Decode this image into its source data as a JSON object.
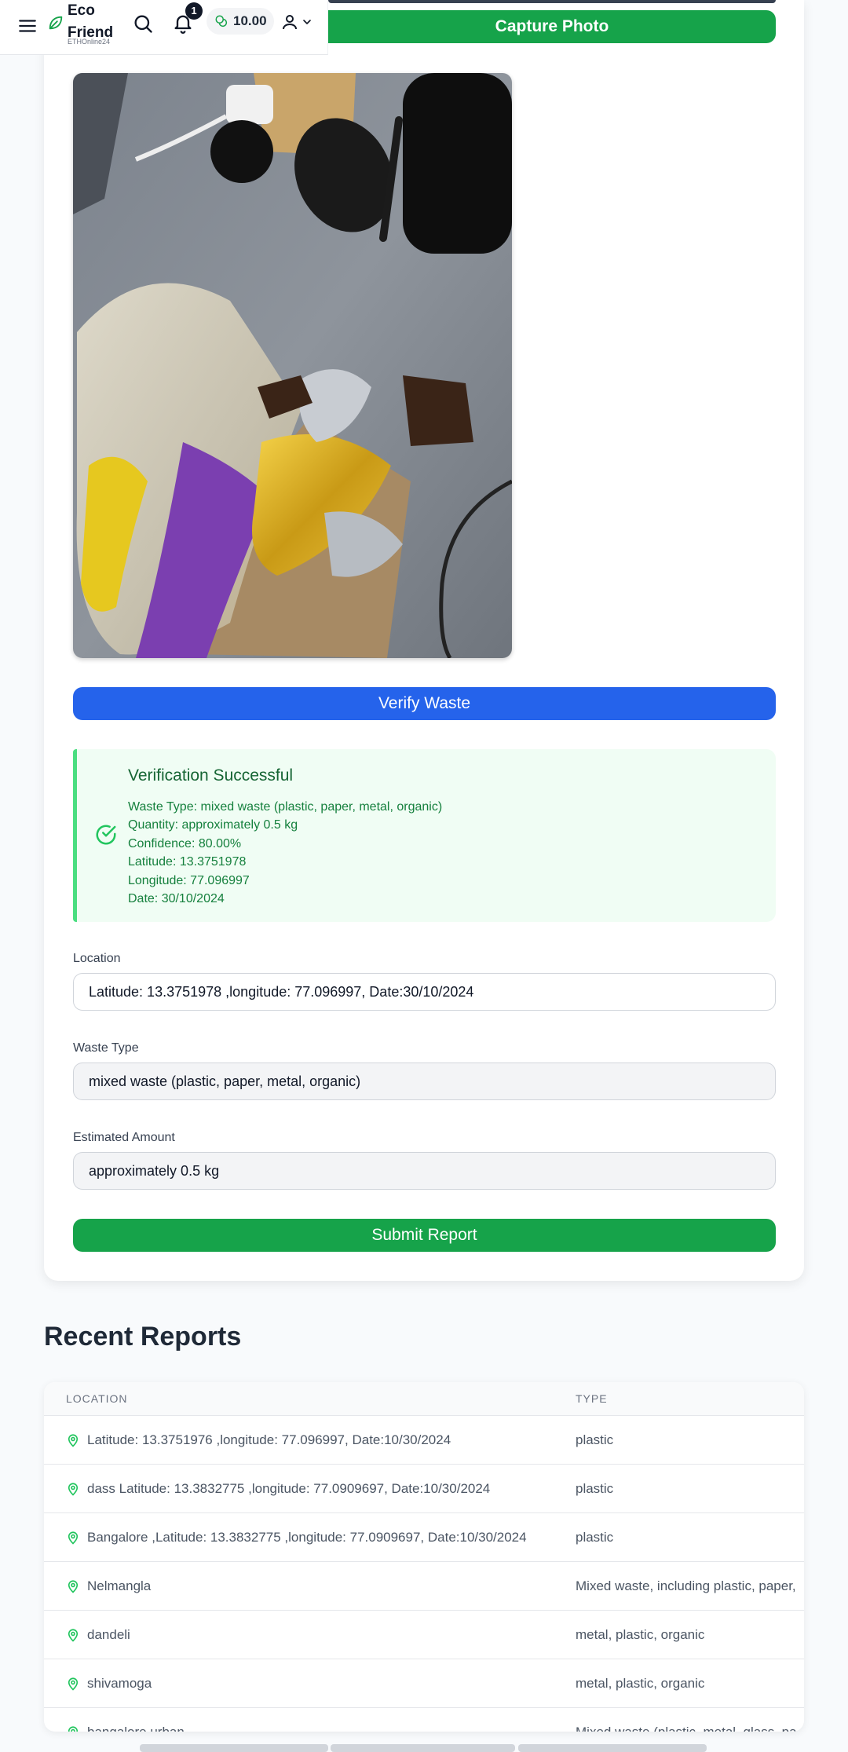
{
  "header": {
    "logo_text": "Eco\nFriend",
    "logo_line1": "Eco",
    "logo_line2": "Friend",
    "logo_sub": "ETHOnline24",
    "notification_count": "1",
    "balance": "10.00"
  },
  "capture": {
    "button_label": "Capture Photo"
  },
  "verify": {
    "button_label": "Verify Waste"
  },
  "verification": {
    "title": "Verification Successful",
    "lines": [
      "Waste Type: mixed waste (plastic, paper, metal, organic)",
      "Quantity: approximately 0.5 kg",
      "Confidence: 80.00%",
      "Latitude: 13.3751978",
      "Longitude: 77.096997",
      "Date: 30/10/2024"
    ]
  },
  "form": {
    "location_label": "Location",
    "location_value": "Latitude: 13.3751978 ,longitude: 77.096997, Date:30/10/2024",
    "waste_type_label": "Waste Type",
    "waste_type_value": "mixed waste (plastic, paper, metal, organic)",
    "amount_label": "Estimated Amount",
    "amount_value": "approximately 0.5 kg",
    "submit_label": "Submit Report"
  },
  "recent": {
    "title": "Recent Reports",
    "columns": [
      "LOCATION",
      "TYPE"
    ],
    "rows": [
      {
        "location": "Latitude: 13.3751976 ,longitude: 77.096997, Date:10/30/2024",
        "type": "plastic"
      },
      {
        "location": "dass Latitude: 13.3832775 ,longitude: 77.0909697, Date:10/30/2024",
        "type": "plastic"
      },
      {
        "location": "Bangalore ,Latitude: 13.3832775 ,longitude: 77.0909697, Date:10/30/2024",
        "type": "plastic"
      },
      {
        "location": "Nelmangla",
        "type": "Mixed waste, including plastic, paper,"
      },
      {
        "location": "dandeli",
        "type": "metal, plastic, organic"
      },
      {
        "location": "shivamoga",
        "type": "metal, plastic, organic"
      },
      {
        "location": "bangalore urban",
        "type": "Mixed waste (plastic, metal, glass, pa"
      }
    ]
  },
  "colors": {
    "green": "#16a34a",
    "blue": "#2563eb",
    "success_bg": "#f0fdf4",
    "success_text": "#166534"
  }
}
